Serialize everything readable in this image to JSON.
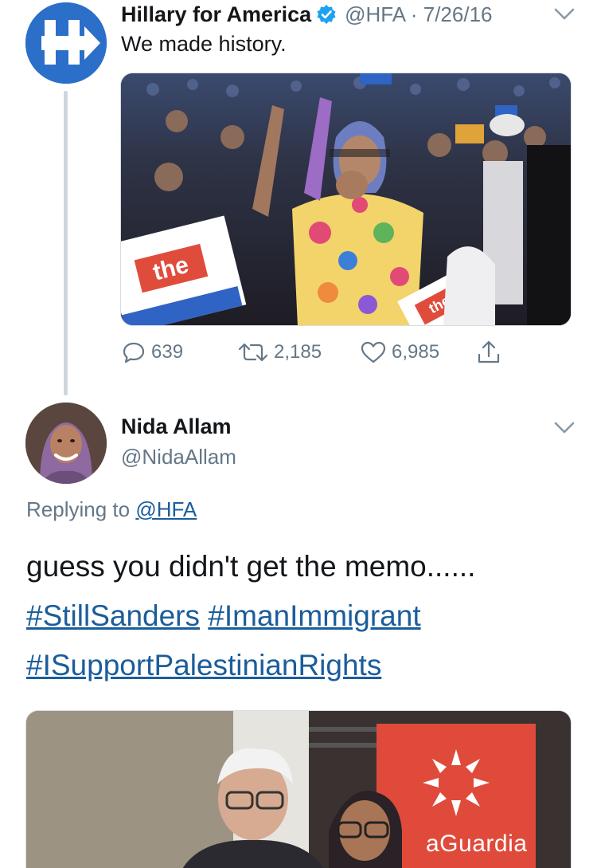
{
  "tweet1": {
    "author_name": "Hillary for America",
    "handle_date": "@HFA · 7/26/16",
    "text": "We made history.",
    "photo_sign_text": "the",
    "photo_sign_text_2": "the",
    "actions": {
      "replies": "639",
      "retweets": "2,185",
      "likes": "6,985"
    },
    "icons": [
      "hfa-logo-icon",
      "verified-icon",
      "chevron-down-icon",
      "reply-icon",
      "retweet-icon",
      "like-icon",
      "share-icon"
    ]
  },
  "tweet2": {
    "author_name": "Nida Allam",
    "handle": "@NidaAllam",
    "replying_prefix": "Replying to",
    "replying_handle": "@HFA",
    "text": "guess you didn't get the memo......",
    "hashtags": [
      "#StillSanders",
      "#ImanImmigrant",
      "#ISupportPalestinianRights"
    ],
    "photo_brand_text": "aGuardia"
  },
  "colors": {
    "link": "#1b5d9b",
    "secondary_text": "#657786",
    "hfa_blue": "#2b6fc9",
    "verified_blue": "#1da1f2",
    "sign_red": "#e04c3c"
  }
}
